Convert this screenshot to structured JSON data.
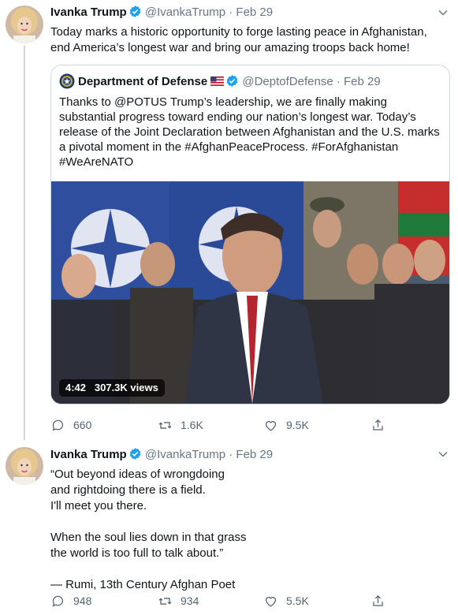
{
  "tweets": [
    {
      "author_name": "Ivanka Trump",
      "handle": "@IvankaTrump",
      "date": "Feb 29",
      "text": "Today marks a historic opportunity to forge lasting peace in Afghanistan, end America’s longest war and bring our amazing troops back home!",
      "quoted": {
        "author_name": "Department of Defense",
        "handle": "@DeptofDefense",
        "date": "Feb 29",
        "text": "Thanks to @POTUS Trump’s leadership, we are finally making substantial progress toward ending our nation’s longest war. Today’s release of the Joint Declaration between Afghanistan and the U.S. marks a pivotal moment in the #AfghanPeaceProcess. #ForAfghanistan #WeAreNATO",
        "video_duration": "4:42",
        "video_views": "307.3K views"
      },
      "actions": {
        "replies": "660",
        "retweets": "1.6K",
        "likes": "9.5K"
      }
    },
    {
      "author_name": "Ivanka Trump",
      "handle": "@IvankaTrump",
      "date": "Feb 29",
      "text": "“Out beyond ideas of wrongdoing\nand rightdoing there is a field.\nI'll meet you there.\n\nWhen the soul lies down in that grass\nthe world is too full to talk about.”\n\n— Rumi, 13th Century Afghan Poet",
      "actions": {
        "replies": "948",
        "retweets": "934",
        "likes": "5.5K"
      }
    }
  ],
  "dot": "·",
  "colors": {
    "verified": "#1da1f2",
    "secondary": "#657786",
    "border": "#cfd9de"
  }
}
